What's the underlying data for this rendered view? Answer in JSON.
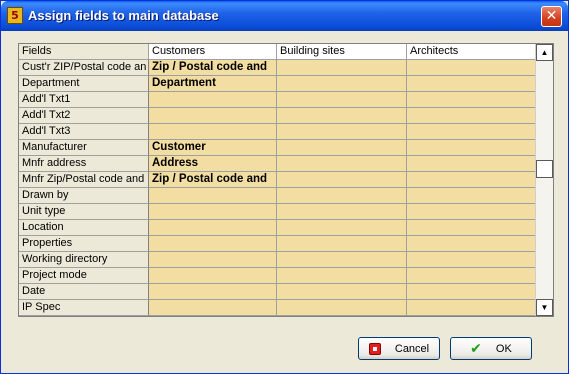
{
  "window": {
    "title": "Assign fields to main database",
    "icon": "app-icon",
    "close_icon": "close-icon"
  },
  "grid": {
    "columns": [
      "Fields",
      "Customers",
      "Building sites",
      "Architects"
    ],
    "rows": [
      {
        "field": "Cust'r ZIP/Postal code an",
        "customers": "Zip / Postal code and",
        "building_sites": "",
        "architects": ""
      },
      {
        "field": "Department",
        "customers": "Department",
        "building_sites": "",
        "architects": ""
      },
      {
        "field": "Add'l Txt1",
        "customers": "",
        "building_sites": "",
        "architects": ""
      },
      {
        "field": "Add'l Txt2",
        "customers": "",
        "building_sites": "",
        "architects": ""
      },
      {
        "field": "Add'l Txt3",
        "customers": "",
        "building_sites": "",
        "architects": ""
      },
      {
        "field": "Manufacturer",
        "customers": "Customer",
        "building_sites": "",
        "architects": ""
      },
      {
        "field": "Mnfr address",
        "customers": "Address",
        "building_sites": "",
        "architects": ""
      },
      {
        "field": "Mnfr Zip/Postal code and",
        "customers": "Zip / Postal code and",
        "building_sites": "",
        "architects": ""
      },
      {
        "field": "Drawn by",
        "customers": "",
        "building_sites": "",
        "architects": ""
      },
      {
        "field": "Unit type",
        "customers": "",
        "building_sites": "",
        "architects": ""
      },
      {
        "field": "Location",
        "customers": "",
        "building_sites": "",
        "architects": ""
      },
      {
        "field": "Properties",
        "customers": "",
        "building_sites": "",
        "architects": ""
      },
      {
        "field": "Working directory",
        "customers": "",
        "building_sites": "",
        "architects": ""
      },
      {
        "field": "Project mode",
        "customers": "",
        "building_sites": "",
        "architects": ""
      },
      {
        "field": "Date",
        "customers": "",
        "building_sites": "",
        "architects": ""
      },
      {
        "field": "IP Spec",
        "customers": "",
        "building_sites": "",
        "architects": ""
      }
    ],
    "scroll_position": 0.45
  },
  "buttons": {
    "cancel": {
      "label": "Cancel",
      "icon": "cancel-icon"
    },
    "ok": {
      "label": "OK",
      "icon": "checkmark-icon"
    }
  },
  "colors": {
    "title_blue": "#0A4BD6",
    "cell_yellow": "#F2DDA2",
    "dialog_bg": "#ECE9D8"
  }
}
